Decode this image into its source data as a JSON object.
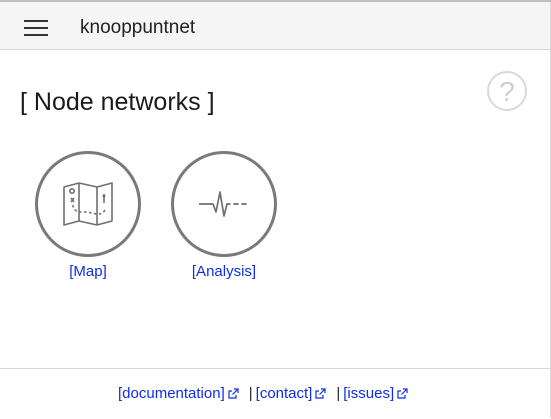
{
  "toolbar": {
    "menu_icon": "menu-icon",
    "title": "knooppuntnet"
  },
  "page": {
    "title": "[ Node networks ]",
    "help_label": "?",
    "help_icon": "help-icon"
  },
  "tiles": [
    {
      "label": "[Map]",
      "icon": "map-icon"
    },
    {
      "label": "[Analysis]",
      "icon": "analysis-icon"
    }
  ],
  "footer": {
    "links": [
      {
        "label": "[documentation]",
        "icon": "external-link-icon"
      },
      {
        "label": "[contact]",
        "icon": "external-link-icon"
      },
      {
        "label": "[issues]",
        "icon": "external-link-icon"
      }
    ],
    "separator": "|"
  },
  "colors": {
    "link": "#0d2ee3",
    "toolbar_background": "#f5f5f5",
    "tile_border": "#7a7a7a"
  }
}
